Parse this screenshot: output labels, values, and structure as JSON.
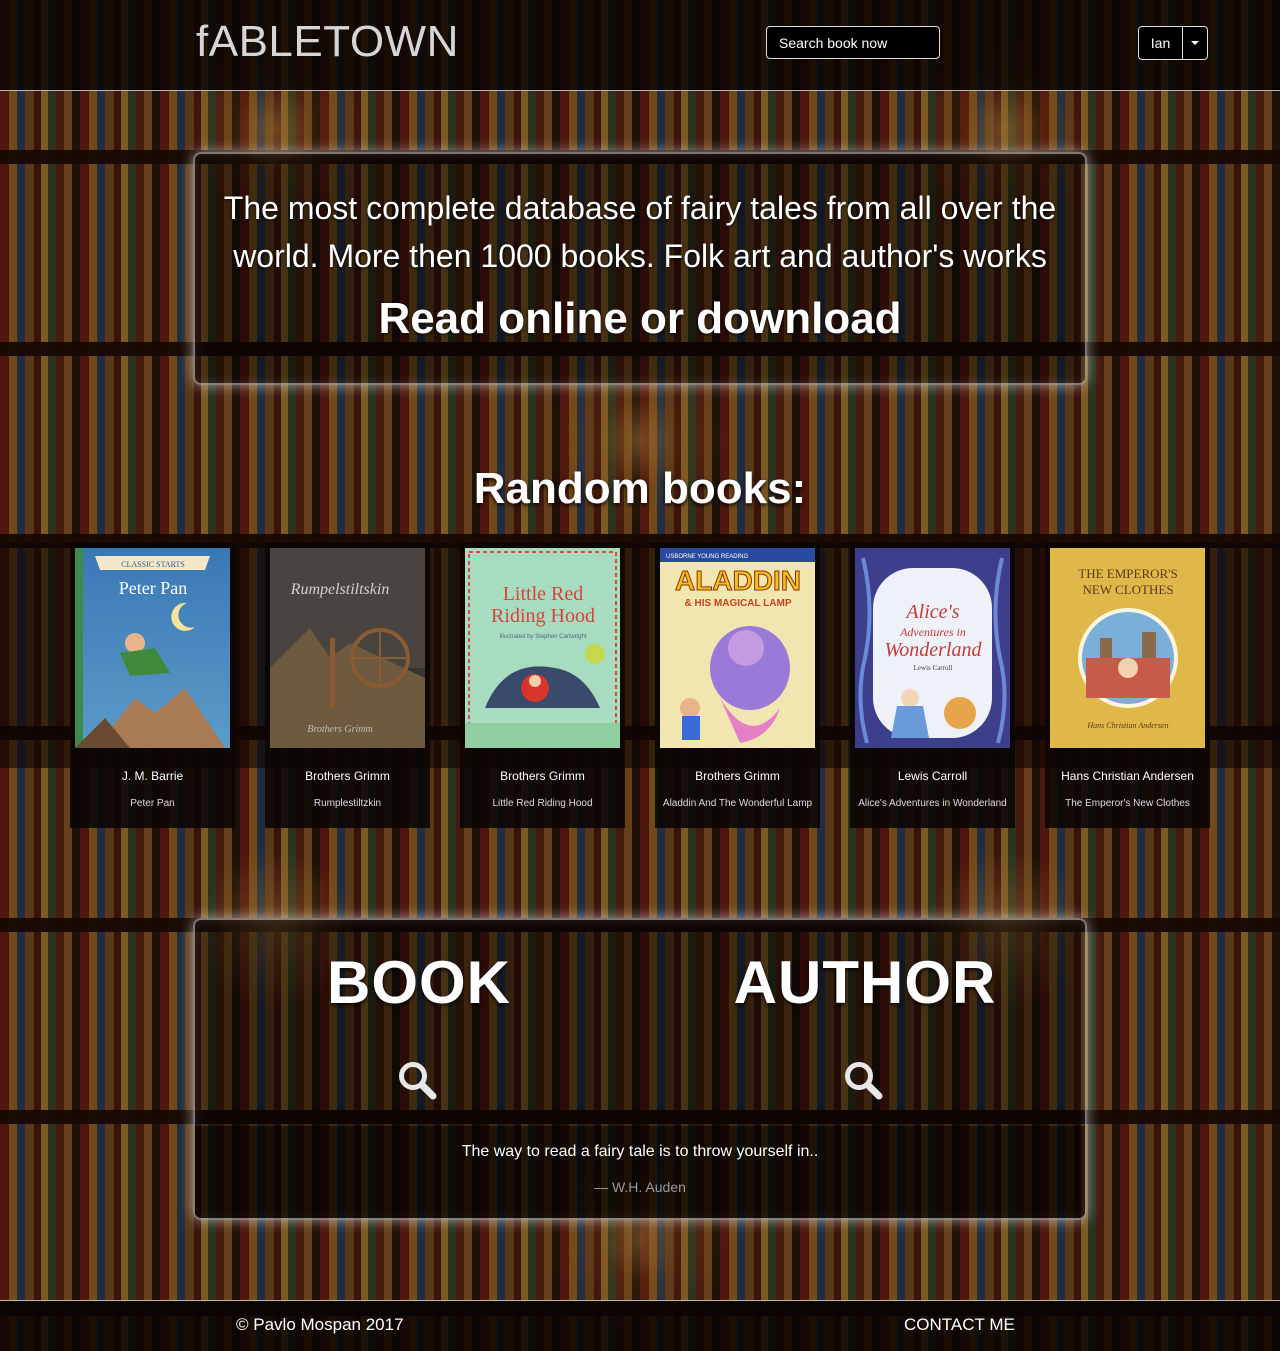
{
  "header": {
    "logo": "fABLETOWN",
    "search_placeholder": "Search book now",
    "language": "Ian"
  },
  "hero": {
    "description": "The most complete database of fairy tales from all over the world. More then 1000 books. Folk art and author's works",
    "cta": "Read online or download"
  },
  "random_books": {
    "title": "Random books:",
    "items": [
      {
        "author": "J. M. Barrie",
        "title": "Peter Pan",
        "cover_text": "Peter Pan",
        "cover_top": "CLASSIC STARTS",
        "cover_color": "#3b7bb0"
      },
      {
        "author": "Brothers Grimm",
        "title": "Rumplestiltzkin",
        "cover_text": "Rumpelstiltskin",
        "cover_top": "Brothers Grimm",
        "cover_color": "#4a4440"
      },
      {
        "author": "Brothers Grimm",
        "title": "Little Red Riding Hood",
        "cover_text": "Little Red Riding Hood",
        "cover_top": "Illustrated by Stephen Cartwright",
        "cover_color": "#a8dcc0"
      },
      {
        "author": "Brothers Grimm",
        "title": "Aladdin And The Wonderful Lamp",
        "cover_text": "ALADDIN",
        "cover_top": "USBORNE YOUNG READING",
        "cover_color": "#2a4aa0"
      },
      {
        "author": "Lewis Carroll",
        "title": "Alice's Adventures in Wonderland",
        "cover_text": "Alice's Adventures in Wonderland",
        "cover_top": "Lewis Carroll",
        "cover_color": "#3d3e8c"
      },
      {
        "author": "Hans Christian Andersen",
        "title": "The Emperor's New Clothes",
        "cover_text": "THE EMPEROR'S NEW CLOTHES",
        "cover_top": "Hans Christian Andersen",
        "cover_color": "#e0b84a"
      }
    ]
  },
  "search_section": {
    "book_label": "BOOK",
    "author_label": "AUTHOR",
    "quote": "The way to read a fairy tale is to throw yourself in..",
    "quote_author": "— W.H. Auden"
  },
  "footer": {
    "copyright": "© Pavlo Mospan 2017",
    "contact": "CONTACT ME"
  },
  "icons": {
    "search": "magnifier-icon",
    "caret": "caret-down-icon"
  }
}
